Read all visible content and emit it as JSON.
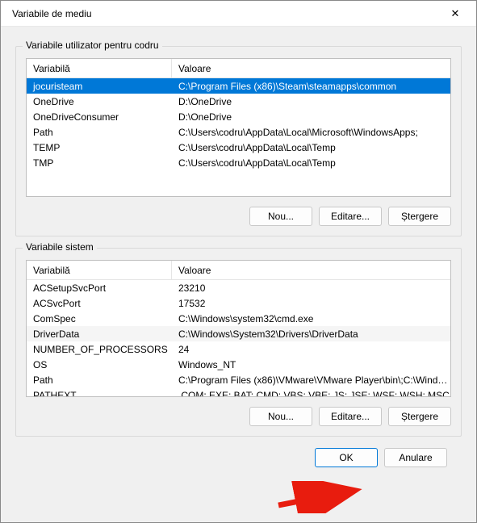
{
  "window": {
    "title": "Variabile de mediu",
    "close": "✕"
  },
  "userGroup": {
    "label": "Variabile utilizator pentru codru",
    "header": {
      "name": "Variabilă",
      "value": "Valoare"
    },
    "rows": [
      {
        "name": "jocuristeam",
        "value": "C:\\Program Files (x86)\\Steam\\steamapps\\common",
        "selected": true
      },
      {
        "name": "OneDrive",
        "value": "D:\\OneDrive"
      },
      {
        "name": "OneDriveConsumer",
        "value": "D:\\OneDrive"
      },
      {
        "name": "Path",
        "value": "C:\\Users\\codru\\AppData\\Local\\Microsoft\\WindowsApps;"
      },
      {
        "name": "TEMP",
        "value": "C:\\Users\\codru\\AppData\\Local\\Temp"
      },
      {
        "name": "TMP",
        "value": "C:\\Users\\codru\\AppData\\Local\\Temp"
      }
    ],
    "buttons": {
      "new": "Nou...",
      "edit": "Editare...",
      "delete": "Ștergere"
    }
  },
  "sysGroup": {
    "label": "Variabile sistem",
    "header": {
      "name": "Variabilă",
      "value": "Valoare"
    },
    "rows": [
      {
        "name": "ACSetupSvcPort",
        "value": "23210"
      },
      {
        "name": "ACSvcPort",
        "value": "17532"
      },
      {
        "name": "ComSpec",
        "value": "C:\\Windows\\system32\\cmd.exe"
      },
      {
        "name": "DriverData",
        "value": "C:\\Windows\\System32\\Drivers\\DriverData",
        "alt": true
      },
      {
        "name": "NUMBER_OF_PROCESSORS",
        "value": "24"
      },
      {
        "name": "OS",
        "value": "Windows_NT"
      },
      {
        "name": "Path",
        "value": "C:\\Program Files (x86)\\VMware\\VMware Player\\bin\\;C:\\Windows\\..."
      },
      {
        "name": "PATHEXT",
        "value": ".COM;.EXE;.BAT;.CMD;.VBS;.VBE;.JS;.JSE;.WSF;.WSH;.MSC"
      }
    ],
    "buttons": {
      "new": "Nou...",
      "edit": "Editare...",
      "delete": "Ștergere"
    }
  },
  "dialog": {
    "ok": "OK",
    "cancel": "Anulare"
  }
}
